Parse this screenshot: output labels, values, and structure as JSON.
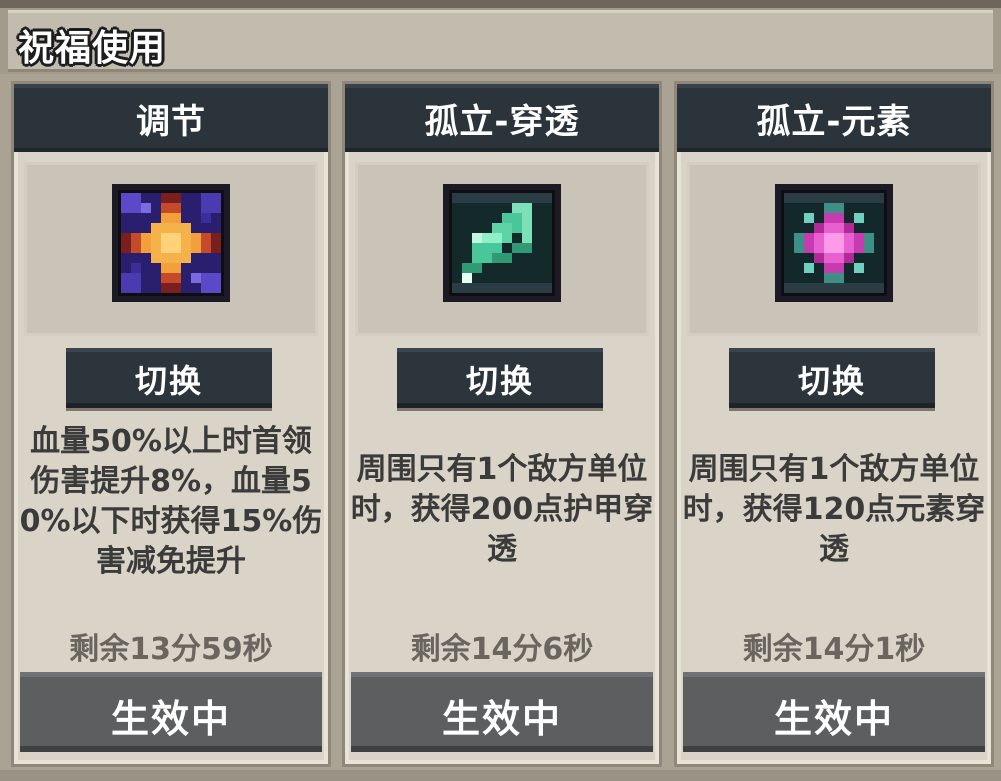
{
  "title": "祝福使用",
  "cards": [
    {
      "name": "调节",
      "icon": "blessing-regulate-icon",
      "switch_label": "切换",
      "description": "血量50%以上时首领伤害提升8%，血量50%以下时获得15%伤害减免提升",
      "remaining": "剩余13分59秒",
      "status_label": "生效中"
    },
    {
      "name": "孤立-穿透",
      "icon": "blessing-isolation-penetration-icon",
      "switch_label": "切换",
      "description": "周围只有1个敌方单位时，获得200点护甲穿透",
      "remaining": "剩余14分6秒",
      "status_label": "生效中"
    },
    {
      "name": "孤立-元素",
      "icon": "blessing-isolation-element-icon",
      "switch_label": "切换",
      "description": "周围只有1个敌方单位时，获得120点元素穿透",
      "remaining": "剩余14分1秒",
      "status_label": "生效中"
    }
  ]
}
